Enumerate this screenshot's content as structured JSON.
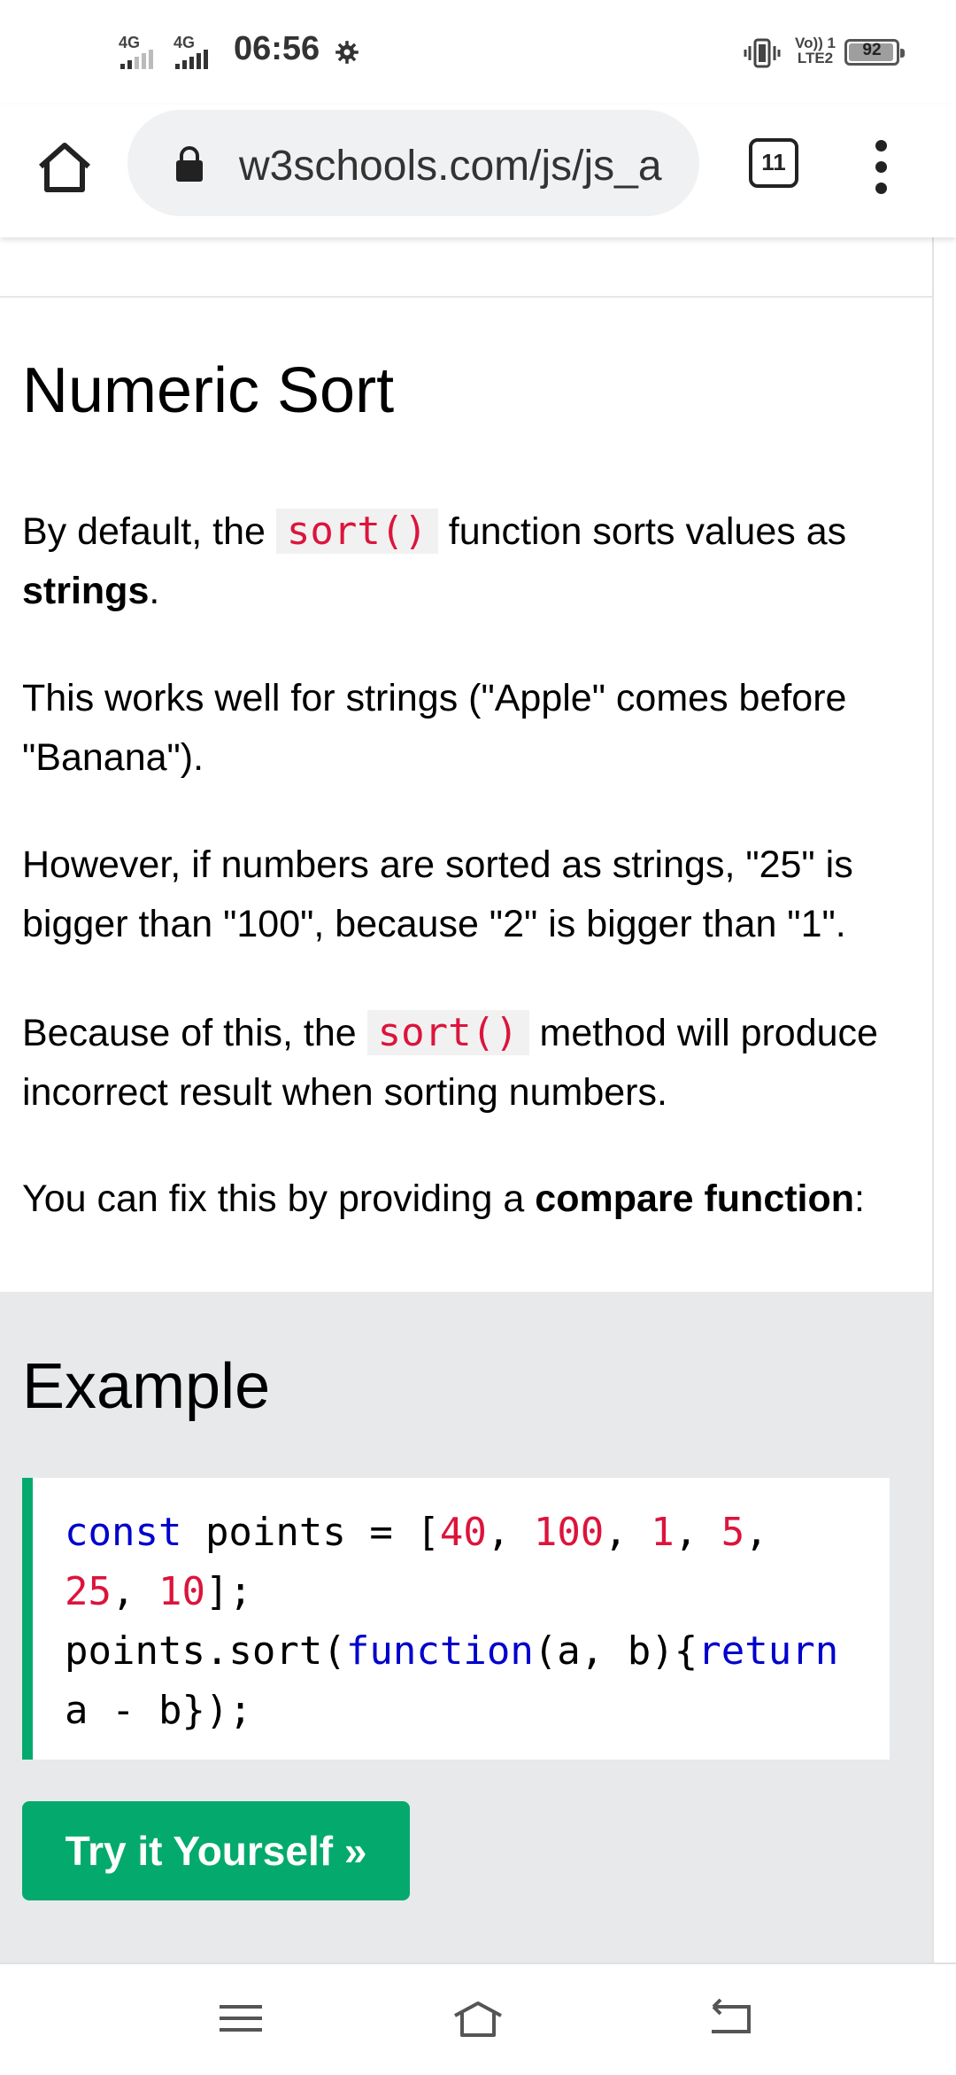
{
  "status_bar": {
    "network_1": "4G",
    "network_2": "4G",
    "time": "06:56",
    "volte_line1": "Vo)) 1",
    "volte_line2": "LTE2",
    "battery": "92",
    "icons": [
      "signal-icon",
      "settings-gear-icon",
      "vibrate-icon",
      "volte-icon",
      "battery-icon"
    ]
  },
  "browser": {
    "url": "w3schools.com/js/js_a",
    "tab_count": "11",
    "icons": [
      "home-icon",
      "lock-icon",
      "tab-switcher-icon",
      "more-vert-icon"
    ]
  },
  "article": {
    "heading": "Numeric Sort",
    "p1_a": "By default, the",
    "p1_code": "sort()",
    "p1_b": "function sorts values as",
    "p1_bold": "strings",
    "p1_c": ".",
    "p2": "This works well for strings (\"Apple\" comes before \"Banana\").",
    "p3": "However, if numbers are sorted as strings, \"25\" is bigger than \"100\", because \"2\" is bigger than \"1\".",
    "p4_a": "Because of this, the",
    "p4_code": "sort()",
    "p4_b": "method will produce incorrect result when sorting numbers.",
    "p5_a": "You can fix this by providing a",
    "p5_bold": "compare function",
    "p5_b": ":"
  },
  "example": {
    "heading": "Example",
    "code": {
      "l1_kw": "const",
      "l1_a": " points = [",
      "l1_n1": "40",
      "l1_s1": ", ",
      "l1_n2": "100",
      "l1_s2": ", ",
      "l1_n3": "1",
      "l1_s3": ", ",
      "l1_n4": "5",
      "l1_s4": ",",
      "l2_n5": "25",
      "l2_s5": ", ",
      "l2_n6": "10",
      "l2_end": "];",
      "l3_a": "points.sort(",
      "l3_kw1": "function",
      "l3_b": "(a, b){",
      "l3_kw2": "return",
      "l4": "a - b});"
    },
    "button_label": "Try it Yourself »"
  },
  "nav_bar": {
    "icons": [
      "menu-lines-icon",
      "home-outline-icon",
      "back-icon"
    ]
  },
  "colors": {
    "accent_green": "#04aa6d",
    "code_red": "#dc143c",
    "code_blue": "#0000cd",
    "example_bg": "#e7e9eb"
  }
}
